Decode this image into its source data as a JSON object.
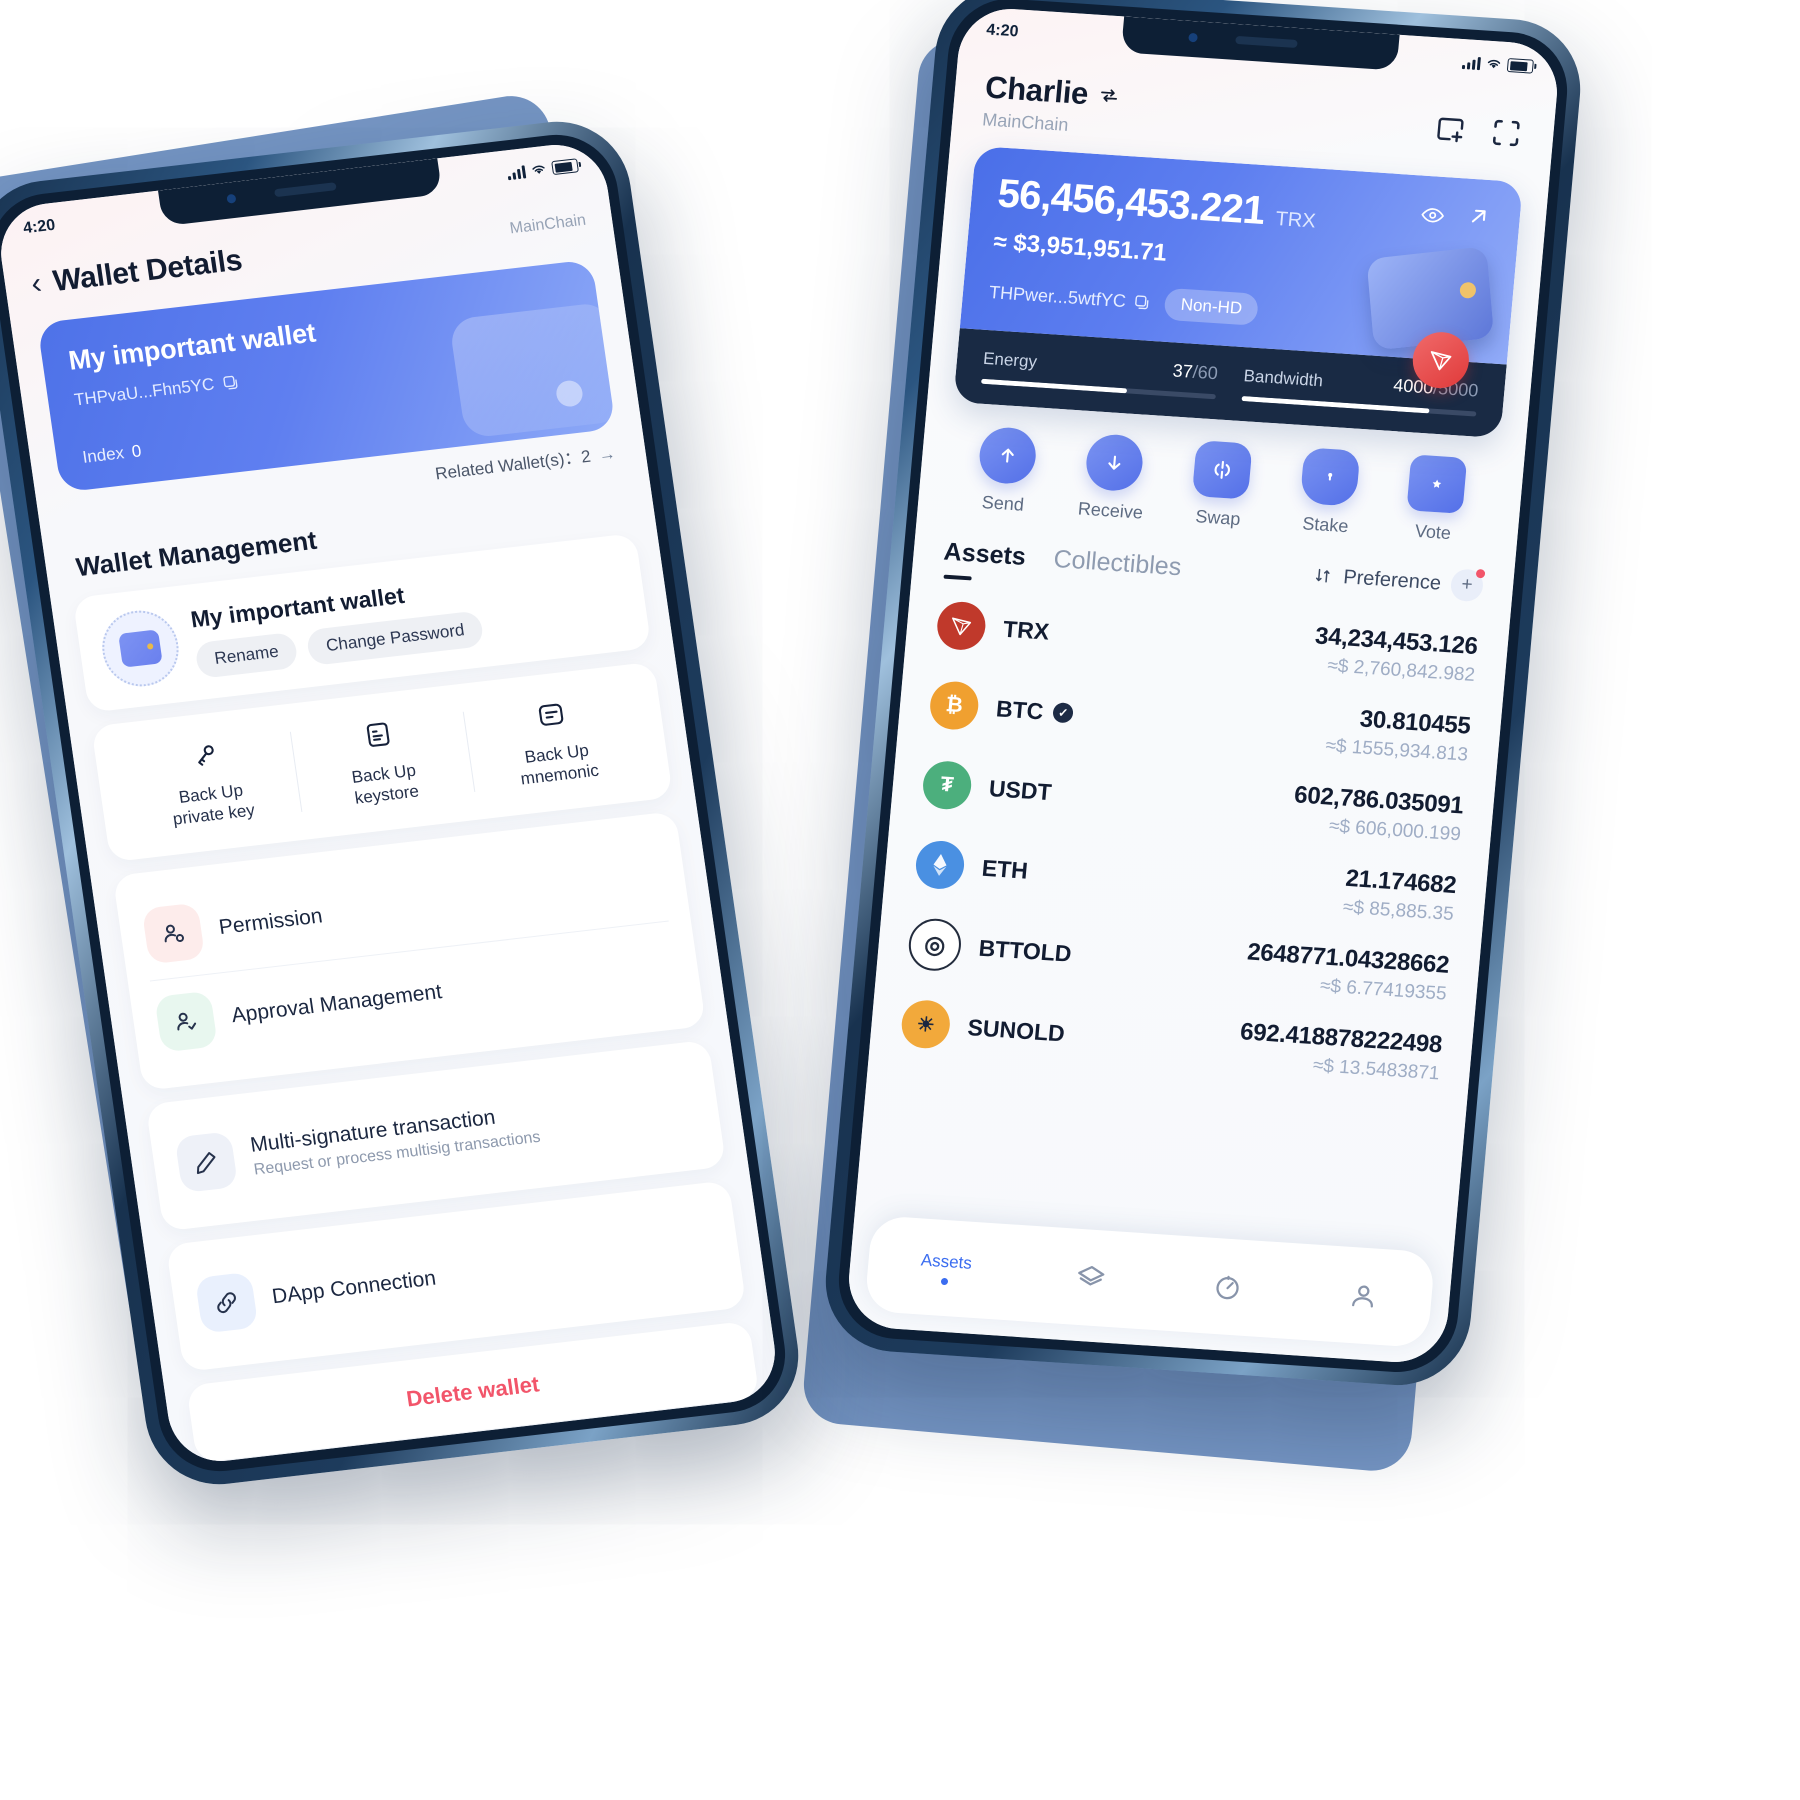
{
  "status_bar": {
    "time": "4:20"
  },
  "left_phone": {
    "header": {
      "title": "Wallet Details",
      "chain": "MainChain",
      "back_icon": "chevron-left-icon"
    },
    "wallet_card": {
      "name": "My important wallet",
      "address": "THPvaU...Fhn5YC",
      "copy_icon": "copy-icon",
      "index_label": "Index",
      "index_value": "0"
    },
    "related": {
      "label": "Related Wallet(s)：2",
      "arrow": "arrow-right-icon"
    },
    "section_title": "Wallet Management",
    "wallet_row": {
      "name": "My important wallet",
      "avatar_icon": "wallet-avatar-icon",
      "rename_label": "Rename",
      "change_password_label": "Change Password"
    },
    "backups": [
      {
        "label": "Back Up\nprivate key",
        "icon": "key-icon"
      },
      {
        "label": "Back Up\nkeystore",
        "icon": "keystore-file-icon"
      },
      {
        "label": "Back Up\nmnemonic",
        "icon": "mnemonic-note-icon"
      }
    ],
    "menu": [
      {
        "title": "Permission",
        "subtitle": "",
        "icon": "permission-user-icon",
        "bg": "#fdeceb"
      },
      {
        "title": "Approval Management",
        "subtitle": "",
        "icon": "approval-user-check-icon",
        "bg": "#e8f7ef"
      },
      {
        "title": "Multi-signature transaction",
        "subtitle": "Request or process multisig transactions",
        "icon": "pencil-icon",
        "bg": "#eef1f8"
      },
      {
        "title": "DApp Connection",
        "subtitle": "",
        "icon": "link-icon",
        "bg": "#e9f0fd"
      }
    ],
    "delete_label": "Delete wallet"
  },
  "right_phone": {
    "header": {
      "account_name": "Charlie",
      "switch_icon": "switch-account-icon",
      "chain": "MainChain",
      "add_wallet_icon": "add-wallet-icon",
      "scan_icon": "scan-qr-icon"
    },
    "balance": {
      "amount": "56,456,453.221",
      "unit": "TRX",
      "usd": "≈ $3,951,951.71",
      "address": "THPwer...5wtfYC",
      "copy_icon": "copy-icon",
      "hd_tag": "Non-HD",
      "eye_icon": "eye-icon",
      "expand_icon": "arrow-up-right-icon",
      "wallet_3d_icon": "wallet-3d-icon",
      "token_badge_icon": "tron-badge-icon"
    },
    "resources": [
      {
        "label": "Energy",
        "used": "37",
        "total": "/60",
        "percent": 62
      },
      {
        "label": "Bandwidth",
        "used": "4000",
        "total": "/5000",
        "percent": 80
      }
    ],
    "quick_actions": [
      {
        "label": "Send",
        "icon": "arrow-up-icon"
      },
      {
        "label": "Receive",
        "icon": "arrow-down-icon"
      },
      {
        "label": "Swap",
        "icon": "swap-icon"
      },
      {
        "label": "Stake",
        "icon": "shield-lock-icon"
      },
      {
        "label": "Vote",
        "icon": "ticket-star-icon"
      }
    ],
    "tabs": [
      {
        "label": "Assets",
        "active": true
      },
      {
        "label": "Collectibles",
        "active": false
      }
    ],
    "preference": {
      "label": "Preference",
      "sort_icon": "sort-arrows-icon",
      "add_icon": "add-token-icon"
    },
    "assets": [
      {
        "symbol": "TRX",
        "verified": false,
        "amount": "34,234,453.126",
        "usd": "≈$ 2,760,842.982",
        "color": "#c0392b",
        "glyph": "△"
      },
      {
        "symbol": "BTC",
        "verified": true,
        "amount": "30.810455",
        "usd": "≈$ 1555,934.813",
        "color": "#f0a030",
        "glyph": "Ƀ"
      },
      {
        "symbol": "USDT",
        "verified": false,
        "amount": "602,786.035091",
        "usd": "≈$ 606,000.199",
        "color": "#4caf7d",
        "glyph": "₮"
      },
      {
        "symbol": "ETH",
        "verified": false,
        "amount": "21.174682",
        "usd": "≈$ 85,885.35",
        "color": "#4a90e2",
        "glyph": "◆"
      },
      {
        "symbol": "BTTOLD",
        "verified": false,
        "amount": "2648771.04328662",
        "usd": "≈$ 6.77419355",
        "color": "#ffffff",
        "glyph": "◎"
      },
      {
        "symbol": "SUNOLD",
        "verified": false,
        "amount": "692.418878222498",
        "usd": "≈$ 13.5483871",
        "color": "#f2a93b",
        "glyph": "☼"
      }
    ],
    "tabbar": [
      {
        "label": "Assets",
        "icon": "assets-icon",
        "active": true
      },
      {
        "label": "",
        "icon": "layers-icon",
        "active": false
      },
      {
        "label": "",
        "icon": "explore-compass-icon",
        "active": false
      },
      {
        "label": "",
        "icon": "profile-icon",
        "active": false
      }
    ]
  },
  "colors": {
    "accent": "#3b6df0",
    "danger": "#f2556a",
    "dark": "#192a44"
  }
}
